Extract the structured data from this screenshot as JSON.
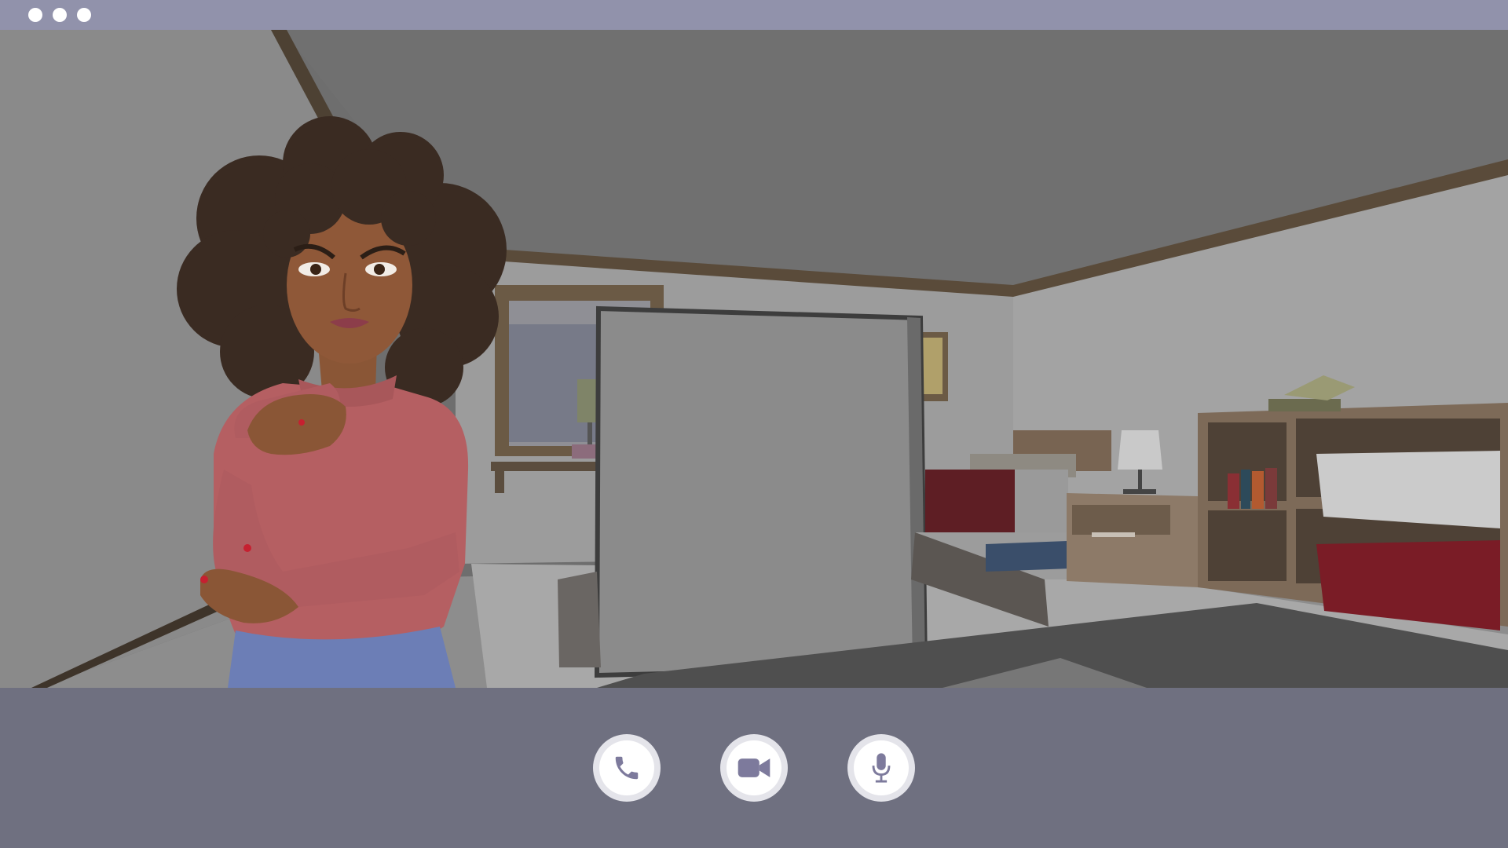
{
  "window": {
    "titlebar_color": "#9192ab",
    "controls_bar_color": "#6f7080",
    "window_dots": [
      "dot",
      "dot",
      "dot"
    ]
  },
  "video_feed": {
    "scene": "bedroom-background",
    "participant": "woman-with-curly-hair"
  },
  "controls": {
    "buttons": [
      {
        "name": "call",
        "icon": "phone-icon"
      },
      {
        "name": "video",
        "icon": "video-camera-icon"
      },
      {
        "name": "microphone",
        "icon": "microphone-icon"
      }
    ],
    "icon_color": "#7d7a9c"
  }
}
